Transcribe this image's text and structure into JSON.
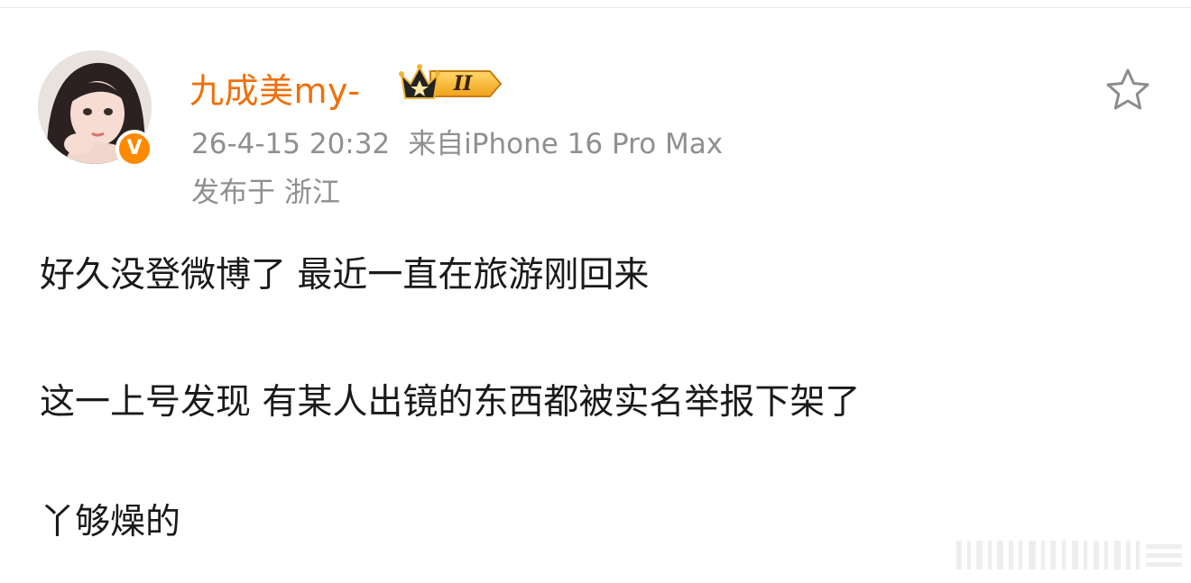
{
  "user": {
    "name": "九成美my-",
    "vip_level": "II",
    "verified_mark": "V",
    "avatar_icon": "avatar-image"
  },
  "post": {
    "time": "26-4-15 20:32",
    "source": "来自iPhone 16 Pro Max",
    "location_prefix": "发布于",
    "location": "浙江",
    "lines": [
      "好久没登微博了 最近一直在旅游刚回来",
      "这一上号发现 有某人出镜的东西都被实名举报下架了",
      "丫够燥的"
    ]
  },
  "actions": {
    "favorite_icon": "star-outline-icon"
  },
  "colors": {
    "username": "#f06f0a",
    "meta": "#8f8f8f",
    "text": "#1a1a1a",
    "verified_badge": "#ff8a00"
  }
}
